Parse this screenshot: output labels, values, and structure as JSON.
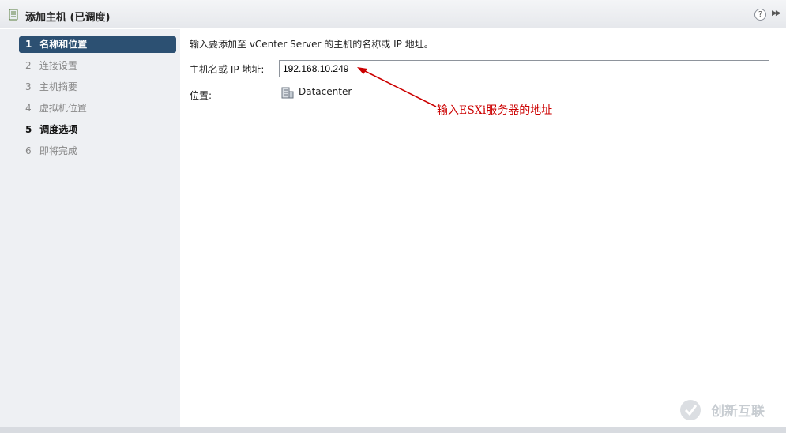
{
  "window": {
    "title": "添加主机 (已调度)"
  },
  "steps": [
    {
      "num": "1",
      "label": "名称和位置",
      "state": "active"
    },
    {
      "num": "2",
      "label": "连接设置",
      "state": "disabled"
    },
    {
      "num": "3",
      "label": "主机摘要",
      "state": "disabled"
    },
    {
      "num": "4",
      "label": "虚拟机位置",
      "state": "disabled"
    },
    {
      "num": "5",
      "label": "调度选项",
      "state": "bold"
    },
    {
      "num": "6",
      "label": "即将完成",
      "state": "disabled"
    }
  ],
  "form": {
    "instruction": "输入要添加至 vCenter Server 的主机的名称或 IP 地址。",
    "host_label": "主机名或 IP 地址:",
    "host_value": "192.168.10.249",
    "location_label": "位置:",
    "location_value": "Datacenter"
  },
  "annotation": {
    "text": "输入ESXi服务器的地址",
    "color": "#cc0000"
  },
  "watermark": {
    "text": "创新互联"
  },
  "icons": {
    "title": "host-icon",
    "help": "help-icon",
    "expand": "expand-icon",
    "datacenter": "datacenter-icon"
  },
  "colors": {
    "active_step_bg": "#2c5072",
    "sidebar_bg": "#eef0f3"
  }
}
